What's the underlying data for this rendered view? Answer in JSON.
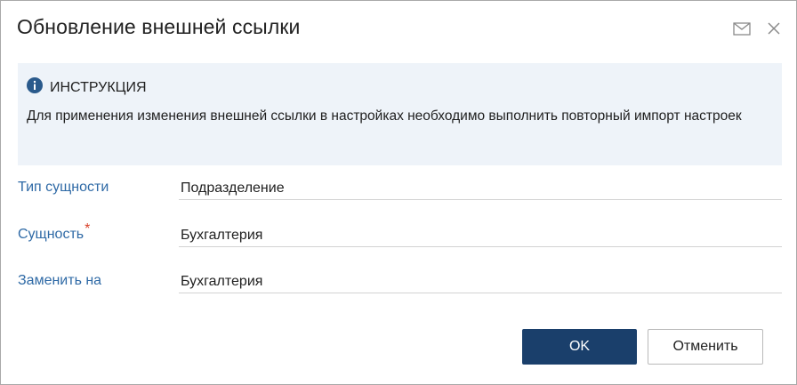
{
  "dialog": {
    "title": "Обновление внешней ссылки",
    "header_icons": [
      "envelope-icon",
      "close-icon"
    ]
  },
  "info": {
    "icon": "info-icon",
    "heading": "ИНСТРУКЦИЯ",
    "text": "Для применения изменения внешней ссылки в настройках необходимо выполнить повторный импорт настроек"
  },
  "fields": {
    "entity_type": {
      "label": "Тип сущности",
      "value": "Подразделение"
    },
    "entity": {
      "label": "Сущность",
      "required_mark": "*",
      "value": "Бухгалтерия"
    },
    "replace_with": {
      "label": "Заменить на",
      "value": "Бухгалтерия"
    }
  },
  "buttons": {
    "ok": "OK",
    "cancel": "Отменить"
  },
  "colors": {
    "accent_label": "#2f6aa6",
    "primary_button": "#1a3f6b",
    "info_bg": "#eef3f9",
    "required": "#d9412a"
  }
}
